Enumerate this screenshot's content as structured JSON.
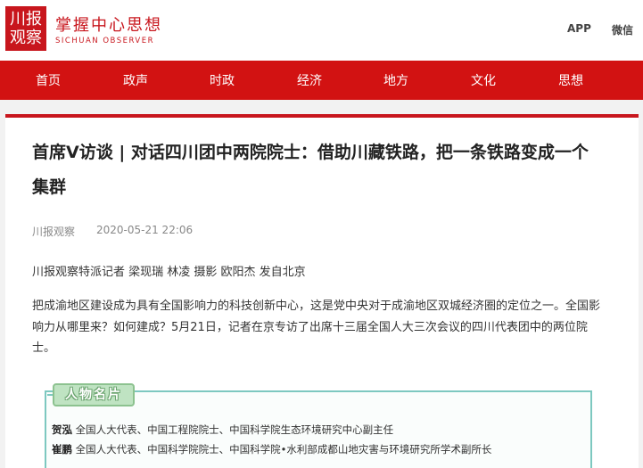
{
  "header": {
    "logo_lines": [
      "川报",
      "观察"
    ],
    "slogan": "掌握中心思想",
    "slogan_en": "SICHUAN OBSERVER",
    "links": [
      "APP",
      "微信"
    ]
  },
  "nav": {
    "items": [
      "首页",
      "政声",
      "时政",
      "经济",
      "地方",
      "文化",
      "思想"
    ]
  },
  "article": {
    "title": "首席V访谈 | 对话四川团中两院院士：借助川藏铁路，把一条铁路变成一个集群",
    "source": "川报观察",
    "date": "2020-05-21 22:06",
    "byline": "川报观察特派记者 梁现瑞 林凌 摄影 欧阳杰 发自北京",
    "lead": "把成渝地区建设成为具有全国影响力的科技创新中心，这是党中央对于成渝地区双城经济圈的定位之一。全国影响力从哪里来？如何建成？5月21日，记者在京专访了出席十三届全国人大三次会议的四川代表团中的两位院士。"
  },
  "profile": {
    "tag": "人物名片",
    "people": [
      {
        "name": "贺泓",
        "desc": "全国人大代表、中国工程院院士、中国科学院生态环境研究中心副主任"
      },
      {
        "name": "崔鹏",
        "desc": "全国人大代表、中国科学院院士、中国科学院•水利部成都山地灾害与环境研究所学术副所长"
      }
    ]
  },
  "colors": {
    "brand_red": "#c8161d",
    "nav_red": "#d21212",
    "profile_border": "#7dc8c0",
    "profile_tag": "#bfe3c2"
  }
}
